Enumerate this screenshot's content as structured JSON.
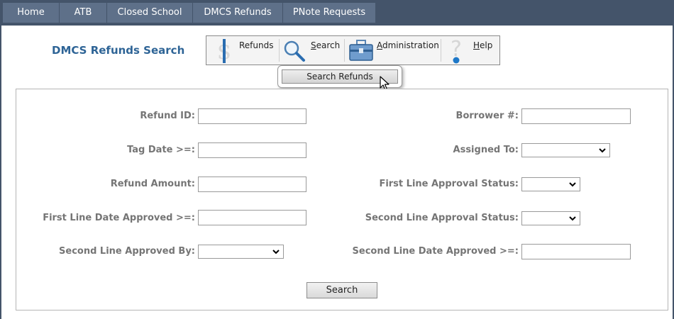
{
  "nav": {
    "tabs": [
      {
        "label": "Home"
      },
      {
        "label": "ATB"
      },
      {
        "label": "Closed School"
      },
      {
        "label": "DMCS Refunds"
      },
      {
        "label": "PNote Requests"
      }
    ]
  },
  "page": {
    "title": "DMCS Refunds Search"
  },
  "toolbar": {
    "refunds": "Refunds",
    "search": "Search",
    "administration": "Administration",
    "help": "Help"
  },
  "menu": {
    "search_refunds": "Search Refunds"
  },
  "form": {
    "refund_id_label": "Refund ID:",
    "refund_id_value": "",
    "tag_date_label": "Tag Date >=:",
    "tag_date_value": "",
    "refund_amount_label": "Refund Amount:",
    "refund_amount_value": "",
    "first_line_date_label": "First Line Date Approved >=:",
    "first_line_date_value": "",
    "second_line_by_label": "Second Line Approved By:",
    "second_line_by_value": "",
    "borrower_label": "Borrower #:",
    "borrower_value": "",
    "assigned_to_label": "Assigned To:",
    "assigned_to_value": "",
    "first_line_status_label": "First Line Approval Status:",
    "first_line_status_value": "",
    "second_line_status_label": "Second Line Approval Status:",
    "second_line_status_value": "",
    "second_line_date_label": "Second Line Date Approved >=:",
    "second_line_date_value": "",
    "search_button": "Search"
  },
  "colors": {
    "nav_bg": "#44546a",
    "tab_bg": "#5e7089",
    "title": "#2e6496",
    "label": "#757575"
  }
}
